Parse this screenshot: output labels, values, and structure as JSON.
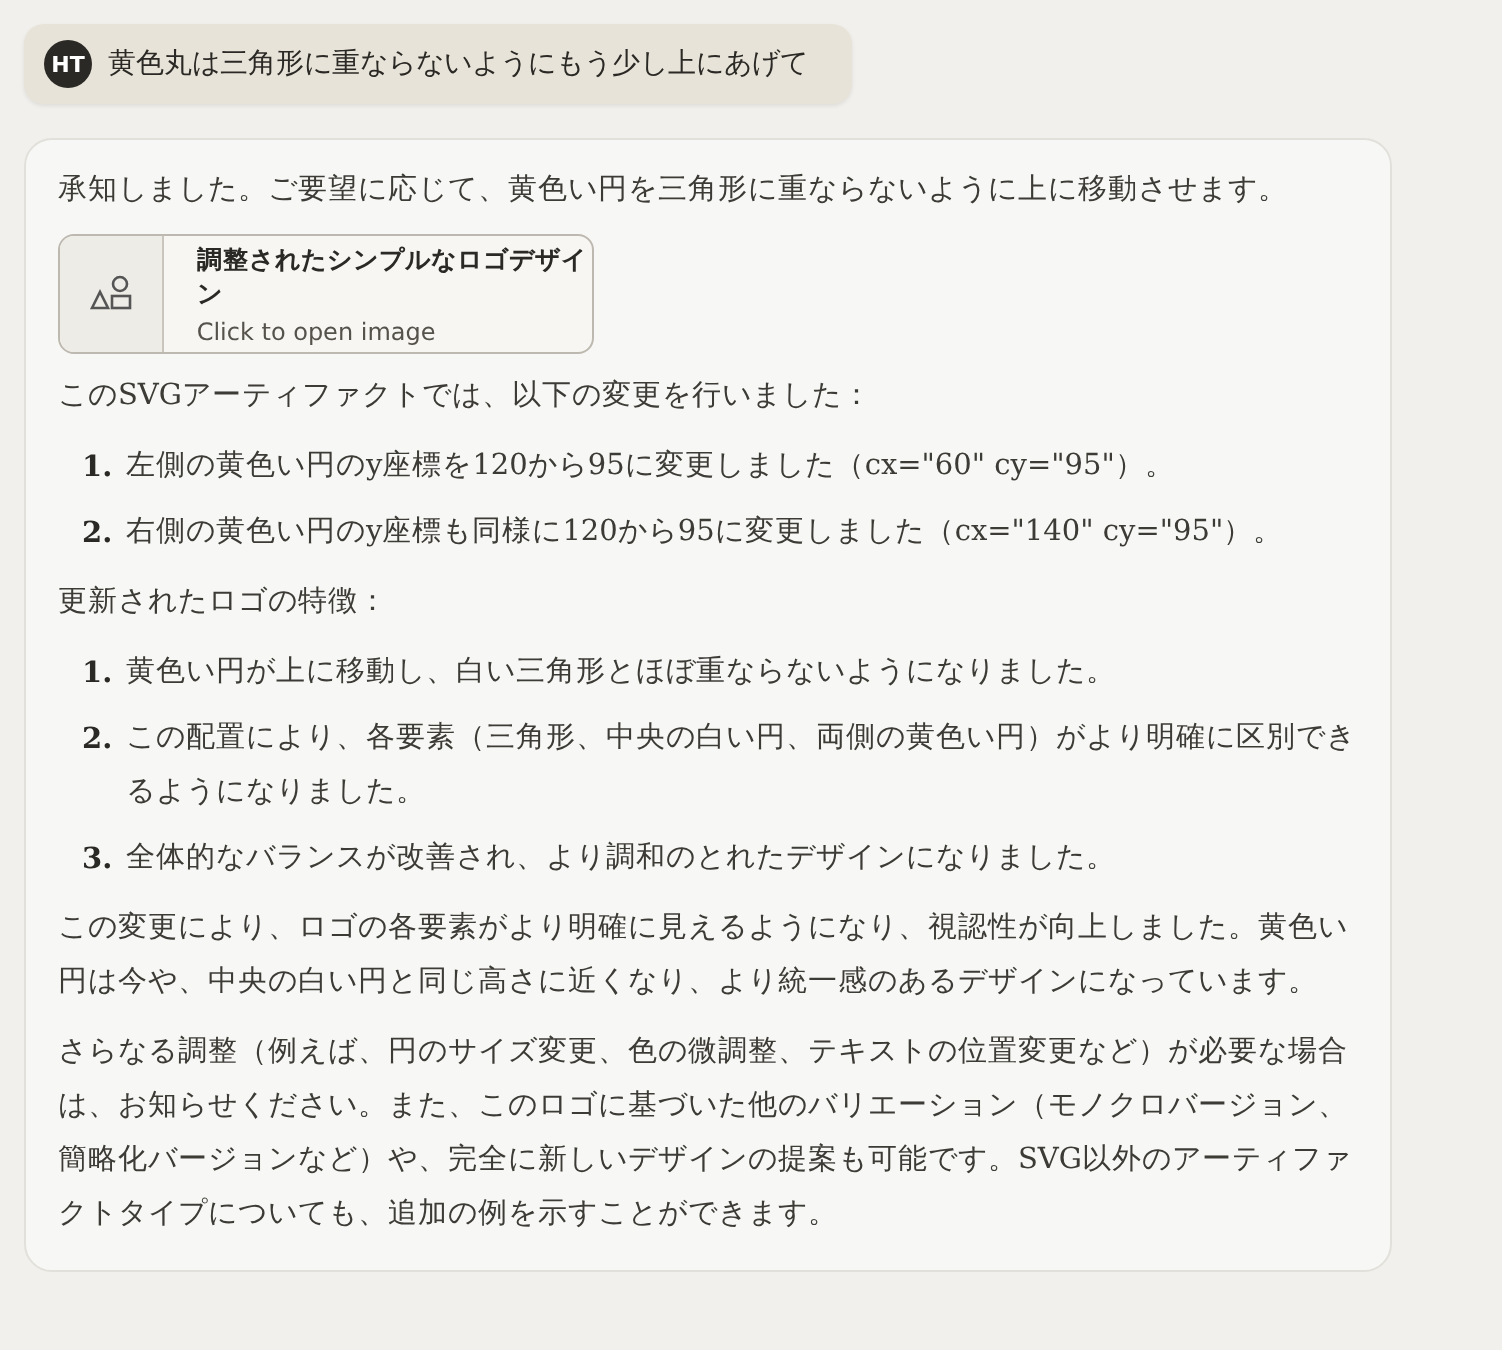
{
  "user_message": {
    "avatar": "HT",
    "text": "黄色丸は三角形に重ならないようにもう少し上にあげて"
  },
  "response": {
    "blocks": [
      {
        "kind": "paragraph",
        "text": "承知しました。ご要望に応じて、黄色い円を三角形に重ならないように上に移動させます。"
      },
      {
        "kind": "artifact",
        "title": "調整されたシンプルなロゴデザイン",
        "subtitle": "Click to open image"
      },
      {
        "kind": "paragraph",
        "text": "このSVGアーティファクトでは、以下の変更を行いました："
      },
      {
        "kind": "list",
        "items": [
          {
            "number": "1.",
            "text": "左側の黄色い円のy座標を120から95に変更しました（cx=\"60\" cy=\"95\"）。"
          },
          {
            "number": "2.",
            "text": "右側の黄色い円のy座標も同様に120から95に変更しました（cx=\"140\" cy=\"95\"）。"
          }
        ]
      },
      {
        "kind": "paragraph",
        "text": "更新されたロゴの特徴："
      },
      {
        "kind": "list",
        "items": [
          {
            "number": "1.",
            "text": "黄色い円が上に移動し、白い三角形とほぼ重ならないようになりました。"
          },
          {
            "number": "2.",
            "text": "この配置により、各要素（三角形、中央の白い円、両側の黄色い円）がより明確に区別できるようになりました。"
          },
          {
            "number": "3.",
            "text": "全体的なバランスが改善され、より調和のとれたデザインになりました。"
          }
        ]
      },
      {
        "kind": "paragraph",
        "text": "この変更により、ロゴの各要素がより明確に見えるようになり、視認性が向上しました。黄色い円は今や、中央の白い円と同じ高さに近くなり、より統一感のあるデザインになっています。"
      },
      {
        "kind": "paragraph",
        "text": "さらなる調整（例えば、円のサイズ変更、色の微調整、テキストの位置変更など）が必要な場合は、お知らせください。また、このロゴに基づいた他のバリエーション（モノクロバージョン、簡略化バージョンなど）や、完全に新しいデザインの提案も可能です。SVG以外のアーティファクトタイプについても、追加の例を示すことができます。"
      }
    ]
  }
}
